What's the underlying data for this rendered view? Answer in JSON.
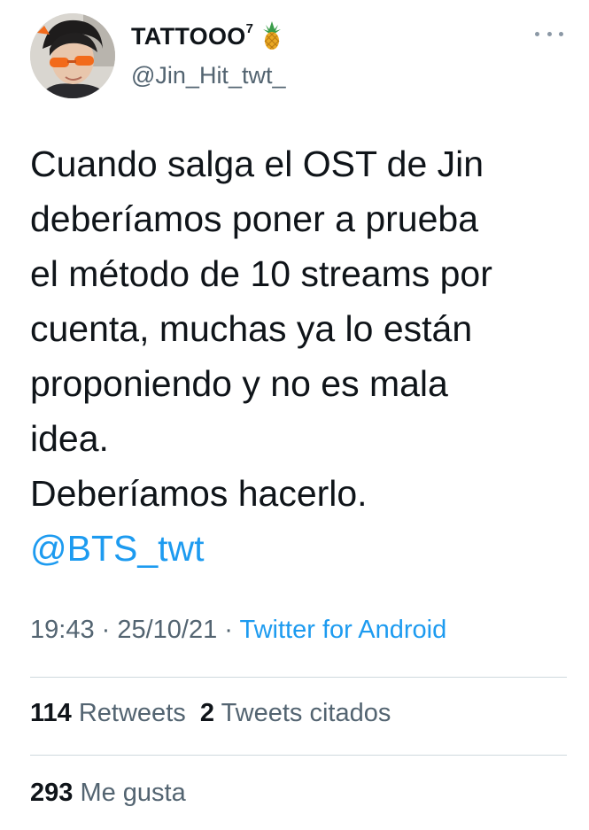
{
  "author": {
    "display_name": "TATTOOO",
    "display_name_superscript": "7",
    "emoji": "pineapple-icon",
    "handle": "@Jin_Hit_twt_"
  },
  "tweet": {
    "lines": [
      "Cuando salga el OST de Jin",
      "deberíamos poner a prueba",
      "el método de 10 streams por",
      "cuenta, muchas ya lo están",
      "proponiendo y no es mala",
      "idea.",
      "Deberíamos hacerlo."
    ],
    "mention": "@BTS_twt"
  },
  "meta": {
    "time": "19:43",
    "separator_1": " · ",
    "date": "25/10/21",
    "separator_2": " · ",
    "source": "Twitter for Android"
  },
  "stats": {
    "retweets_count": "114",
    "retweets_label": "Retweets",
    "quotes_count": "2",
    "quotes_label": "Tweets citados",
    "likes_count": "293",
    "likes_label": "Me gusta"
  },
  "colors": {
    "text": "#0f1419",
    "secondary": "#536471",
    "link": "#1d9bf0",
    "divider": "#cfd9de"
  }
}
